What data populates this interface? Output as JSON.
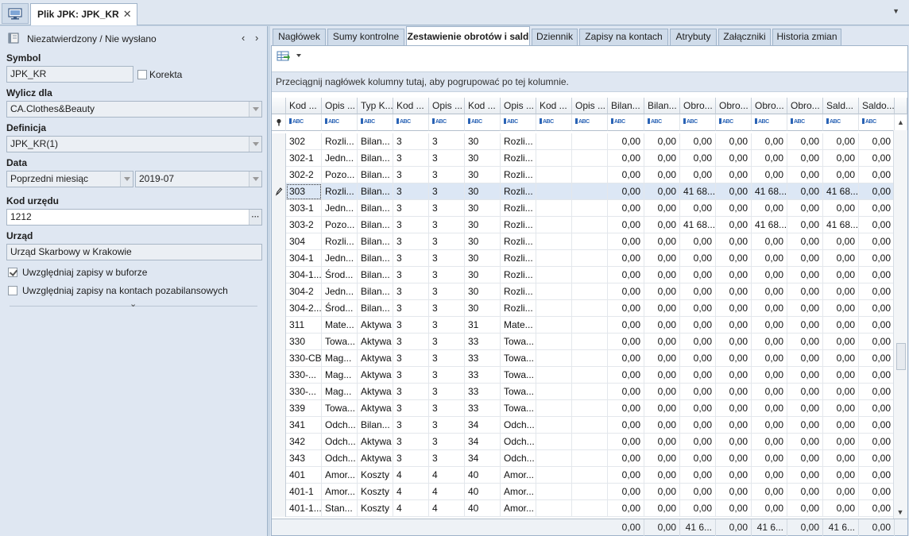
{
  "top": {
    "tab_title": "Plik JPK: JPK_KR",
    "close_glyph": "✕",
    "dropdown_glyph": "▼"
  },
  "left": {
    "status_text": "Niezatwierdzony / Nie wysłano",
    "nav_prev": "‹",
    "nav_next": "›",
    "symbol_label": "Symbol",
    "symbol_value": "JPK_KR",
    "correction_label": "Korekta",
    "calc_for_label": "Wylicz dla",
    "calc_for_value": "CA.Clothes&Beauty",
    "definition_label": "Definicja",
    "definition_value": "JPK_KR(1)",
    "date_label": "Data",
    "date_period_value": "Poprzedni miesiąc",
    "date_month_value": "2019-07",
    "office_code_label": "Kod urzędu",
    "office_code_value": "1212",
    "ellipsis_glyph": "···",
    "office_label": "Urząd",
    "office_value": "Urząd Skarbowy w Krakowie",
    "include_buffer_label": "Uwzględniaj zapisy w buforze",
    "include_buffer_checked": true,
    "include_offbalance_label": "Uwzględniaj zapisy na kontach pozabilansowych",
    "include_offbalance_checked": false,
    "collapse_glyph": "⌄"
  },
  "tabs": [
    {
      "label": "Nagłówek",
      "active": false
    },
    {
      "label": "Sumy kontrolne",
      "active": false
    },
    {
      "label": "Zestawienie obrotów i sald",
      "active": true
    },
    {
      "label": "Dziennik",
      "active": false
    },
    {
      "label": "Zapisy na kontach",
      "active": false
    },
    {
      "label": "Atrybuty",
      "active": false
    },
    {
      "label": "Załączniki",
      "active": false
    },
    {
      "label": "Historia zmian",
      "active": false
    }
  ],
  "grid": {
    "group_hint": "Przeciągnij nagłówek kolumny tutaj, aby pogrupować po tej kolumnie.",
    "filter_glyph": "ABC",
    "columns": [
      "Kod ...",
      "Opis ...",
      "Typ K...",
      "Kod ...",
      "Opis ...",
      "Kod ...",
      "Opis ...",
      "Kod ...",
      "Opis ...",
      "Bilan...",
      "Bilan...",
      "Obro...",
      "Obro...",
      "Obro...",
      "Obro...",
      "Sald...",
      "Saldo..."
    ],
    "rows": [
      [
        "302",
        "Rozli...",
        "Bilan...",
        "3",
        "3",
        "30",
        "Rozli...",
        "",
        "",
        "0,00",
        "0,00",
        "0,00",
        "0,00",
        "0,00",
        "0,00",
        "0,00",
        "0,00"
      ],
      [
        "302-1",
        "Jedn...",
        "Bilan...",
        "3",
        "3",
        "30",
        "Rozli...",
        "",
        "",
        "0,00",
        "0,00",
        "0,00",
        "0,00",
        "0,00",
        "0,00",
        "0,00",
        "0,00"
      ],
      [
        "302-2",
        "Pozo...",
        "Bilan...",
        "3",
        "3",
        "30",
        "Rozli...",
        "",
        "",
        "0,00",
        "0,00",
        "0,00",
        "0,00",
        "0,00",
        "0,00",
        "0,00",
        "0,00"
      ],
      [
        "303",
        "Rozli...",
        "Bilan...",
        "3",
        "3",
        "30",
        "Rozli...",
        "",
        "",
        "0,00",
        "0,00",
        "41 68...",
        "0,00",
        "41 68...",
        "0,00",
        "41 68...",
        "0,00"
      ],
      [
        "303-1",
        "Jedn...",
        "Bilan...",
        "3",
        "3",
        "30",
        "Rozli...",
        "",
        "",
        "0,00",
        "0,00",
        "0,00",
        "0,00",
        "0,00",
        "0,00",
        "0,00",
        "0,00"
      ],
      [
        "303-2",
        "Pozo...",
        "Bilan...",
        "3",
        "3",
        "30",
        "Rozli...",
        "",
        "",
        "0,00",
        "0,00",
        "41 68...",
        "0,00",
        "41 68...",
        "0,00",
        "41 68...",
        "0,00"
      ],
      [
        "304",
        "Rozli...",
        "Bilan...",
        "3",
        "3",
        "30",
        "Rozli...",
        "",
        "",
        "0,00",
        "0,00",
        "0,00",
        "0,00",
        "0,00",
        "0,00",
        "0,00",
        "0,00"
      ],
      [
        "304-1",
        "Jedn...",
        "Bilan...",
        "3",
        "3",
        "30",
        "Rozli...",
        "",
        "",
        "0,00",
        "0,00",
        "0,00",
        "0,00",
        "0,00",
        "0,00",
        "0,00",
        "0,00"
      ],
      [
        "304-1...",
        "Środ...",
        "Bilan...",
        "3",
        "3",
        "30",
        "Rozli...",
        "",
        "",
        "0,00",
        "0,00",
        "0,00",
        "0,00",
        "0,00",
        "0,00",
        "0,00",
        "0,00"
      ],
      [
        "304-2",
        "Jedn...",
        "Bilan...",
        "3",
        "3",
        "30",
        "Rozli...",
        "",
        "",
        "0,00",
        "0,00",
        "0,00",
        "0,00",
        "0,00",
        "0,00",
        "0,00",
        "0,00"
      ],
      [
        "304-2...",
        "Środ...",
        "Bilan...",
        "3",
        "3",
        "30",
        "Rozli...",
        "",
        "",
        "0,00",
        "0,00",
        "0,00",
        "0,00",
        "0,00",
        "0,00",
        "0,00",
        "0,00"
      ],
      [
        "311",
        "Mate...",
        "Aktywa",
        "3",
        "3",
        "31",
        "Mate...",
        "",
        "",
        "0,00",
        "0,00",
        "0,00",
        "0,00",
        "0,00",
        "0,00",
        "0,00",
        "0,00"
      ],
      [
        "330",
        "Towa...",
        "Aktywa",
        "3",
        "3",
        "33",
        "Towa...",
        "",
        "",
        "0,00",
        "0,00",
        "0,00",
        "0,00",
        "0,00",
        "0,00",
        "0,00",
        "0,00"
      ],
      [
        "330-CB",
        "Mag...",
        "Aktywa",
        "3",
        "3",
        "33",
        "Towa...",
        "",
        "",
        "0,00",
        "0,00",
        "0,00",
        "0,00",
        "0,00",
        "0,00",
        "0,00",
        "0,00"
      ],
      [
        "330-...",
        "Mag...",
        "Aktywa",
        "3",
        "3",
        "33",
        "Towa...",
        "",
        "",
        "0,00",
        "0,00",
        "0,00",
        "0,00",
        "0,00",
        "0,00",
        "0,00",
        "0,00"
      ],
      [
        "330-...",
        "Mag...",
        "Aktywa",
        "3",
        "3",
        "33",
        "Towa...",
        "",
        "",
        "0,00",
        "0,00",
        "0,00",
        "0,00",
        "0,00",
        "0,00",
        "0,00",
        "0,00"
      ],
      [
        "339",
        "Towa...",
        "Aktywa",
        "3",
        "3",
        "33",
        "Towa...",
        "",
        "",
        "0,00",
        "0,00",
        "0,00",
        "0,00",
        "0,00",
        "0,00",
        "0,00",
        "0,00"
      ],
      [
        "341",
        "Odch...",
        "Bilan...",
        "3",
        "3",
        "34",
        "Odch...",
        "",
        "",
        "0,00",
        "0,00",
        "0,00",
        "0,00",
        "0,00",
        "0,00",
        "0,00",
        "0,00"
      ],
      [
        "342",
        "Odch...",
        "Aktywa",
        "3",
        "3",
        "34",
        "Odch...",
        "",
        "",
        "0,00",
        "0,00",
        "0,00",
        "0,00",
        "0,00",
        "0,00",
        "0,00",
        "0,00"
      ],
      [
        "343",
        "Odch...",
        "Aktywa",
        "3",
        "3",
        "34",
        "Odch...",
        "",
        "",
        "0,00",
        "0,00",
        "0,00",
        "0,00",
        "0,00",
        "0,00",
        "0,00",
        "0,00"
      ],
      [
        "401",
        "Amor...",
        "Koszty",
        "4",
        "4",
        "40",
        "Amor...",
        "",
        "",
        "0,00",
        "0,00",
        "0,00",
        "0,00",
        "0,00",
        "0,00",
        "0,00",
        "0,00"
      ],
      [
        "401-1",
        "Amor...",
        "Koszty",
        "4",
        "4",
        "40",
        "Amor...",
        "",
        "",
        "0,00",
        "0,00",
        "0,00",
        "0,00",
        "0,00",
        "0,00",
        "0,00",
        "0,00"
      ],
      [
        "401-1...",
        "Stan...",
        "Koszty",
        "4",
        "4",
        "40",
        "Amor...",
        "",
        "",
        "0,00",
        "0,00",
        "0,00",
        "0,00",
        "0,00",
        "0,00",
        "0,00",
        "0,00"
      ]
    ],
    "selected_row": 3,
    "totals": [
      "0,00",
      "0,00",
      "41 6...",
      "0,00",
      "41 6...",
      "0,00",
      "41 6...",
      "0,00"
    ],
    "scroll_up": "▲",
    "scroll_down": "▼"
  },
  "icons": {
    "home": "monitor-icon",
    "status": "book-icon",
    "export": "export-grid-icon",
    "pencil": "pencil-icon",
    "pin": "pin-icon"
  }
}
